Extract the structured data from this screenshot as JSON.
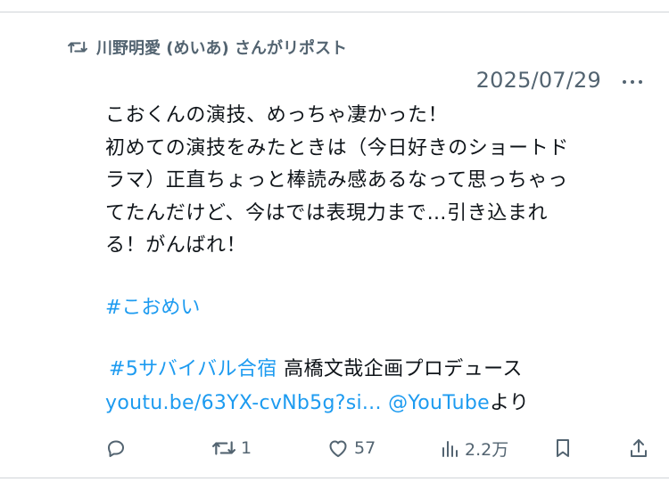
{
  "repost": {
    "icon": "repost-icon",
    "text": "川野明愛 (めいあ) さんがリポスト"
  },
  "meta": {
    "date": "2025/07/29",
    "more_icon": "more-icon"
  },
  "tweet": {
    "lines": [
      "こおくんの演技、めっちゃ凄かった！",
      "初めての演技をみたときは（今日好きのショートド",
      "ラマ）正直ちょっと棒読み感あるなって思っちゃっ",
      "てたんだけど、今はでは表現力まで…引き込まれ",
      "る！がんばれ！"
    ],
    "hashtag": "#こおめい",
    "promo_hashtag": "#5サバイバル合宿",
    "promo_text": " 高橋文哉企画プロデュース",
    "url": "youtu.be/63YX-cvNb5g?si...",
    "mention": "@YouTube",
    "mention_suffix": "より"
  },
  "actions": {
    "reply": {
      "icon": "reply-icon",
      "count": ""
    },
    "repost": {
      "icon": "repost-icon",
      "count": "1"
    },
    "like": {
      "icon": "heart-icon",
      "count": "57"
    },
    "views": {
      "icon": "views-chart-icon",
      "count": "2.2万"
    },
    "bookmark": {
      "icon": "bookmark-icon",
      "count": ""
    },
    "share": {
      "icon": "share-icon",
      "count": ""
    }
  },
  "colors": {
    "text": "#0f1419",
    "secondary": "#536471",
    "link": "#1d9bf0"
  }
}
